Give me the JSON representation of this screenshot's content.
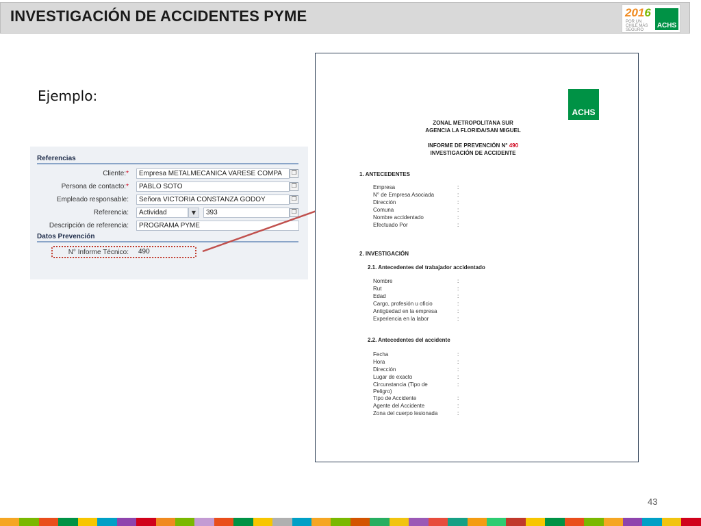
{
  "slide": {
    "title": "INVESTIGACIÓN DE ACCIDENTES PYME",
    "logo": {
      "year": "2016",
      "tagline": "POR UN CHILE MÁS SEGURO",
      "brand": "ACHS"
    },
    "example_label": "Ejemplo:",
    "page_number": "43"
  },
  "form": {
    "section_referencias": "Referencias",
    "fields": [
      {
        "label": "Cliente:",
        "required": "*",
        "value": "Empresa METALMECANICA VARESE COMPA"
      },
      {
        "label": "Persona de contacto:",
        "required": "*",
        "value": "PABLO SOTO"
      },
      {
        "label": "Empleado responsable:",
        "required": "",
        "value": "Señora VICTORIA CONSTANZA GODOY"
      },
      {
        "label": "Referencia:",
        "required": "",
        "value": "Actividad",
        "value2": "393"
      },
      {
        "label": "Descripción de referencia:",
        "required": "",
        "value": "PROGRAMA PYME"
      }
    ],
    "section_prevencion": "Datos Prevención",
    "informe_label": "N° Informe Técnico:",
    "informe_value": "490",
    "lookup_icon": "❐",
    "dropdown_icon": "▼"
  },
  "document": {
    "logo": "ACHS",
    "header_line1": "ZONAL METROPOLITANA SUR",
    "header_line2": "AGENCIA LA FLORIDA/SAN MIGUEL",
    "informe_label": "INFORME DE PREVENCIÓN N°",
    "informe_number": "490",
    "subtitle": "INVESTIGACIÓN DE ACCIDENTE",
    "s1_title": "1. ANTECEDENTES",
    "s1_items": [
      "Empresa",
      "N° de Empresa Asociada",
      "Dirección",
      "Comuna",
      "Nombre accidentado",
      "Efectuado Por"
    ],
    "s2_title": "2. INVESTIGACIÓN",
    "s21_title": "2.1. Antecedentes del trabajador accidentado",
    "s21_items": [
      "Nombre",
      "Rut",
      "Edad",
      "Cargo, profesión u oficio",
      "Antigüedad en la empresa",
      "Experiencia en la labor"
    ],
    "s22_title": "2.2. Antecedentes del accidente",
    "s22_items": [
      "Fecha",
      "Hora",
      "Dirección",
      "Lugar de exacto",
      "Circunstancia (Tipo de",
      "Peligro)",
      "Tipo de Accidente",
      "Agente del Accidente",
      "Zona del cuerpo lesionada"
    ],
    "colon": ":"
  },
  "colors": {
    "achs_green": "#009245",
    "highlight_red": "#c0392b",
    "arrow_red": "#c0504d",
    "title_bar": "#d9d9d9",
    "stripe": [
      "#f5a623",
      "#7ab800",
      "#e94e1b",
      "#009245",
      "#f7c600",
      "#00a0c6",
      "#8e44ad",
      "#d0021b",
      "#f08a1f",
      "#7ab800",
      "#c39bd3",
      "#e94e1b",
      "#009245",
      "#f7c600",
      "#b0b0b0",
      "#00a0c6",
      "#f5a623",
      "#7ab800",
      "#d35400",
      "#27ae60",
      "#f1c40f",
      "#9b59b6",
      "#e74c3c",
      "#16a085",
      "#f39c12",
      "#2ecc71",
      "#c0392b",
      "#f7c600",
      "#009245",
      "#e94e1b",
      "#7ab800",
      "#f5a623",
      "#8e44ad",
      "#00a0c6",
      "#f1c40f",
      "#d0021b"
    ]
  }
}
